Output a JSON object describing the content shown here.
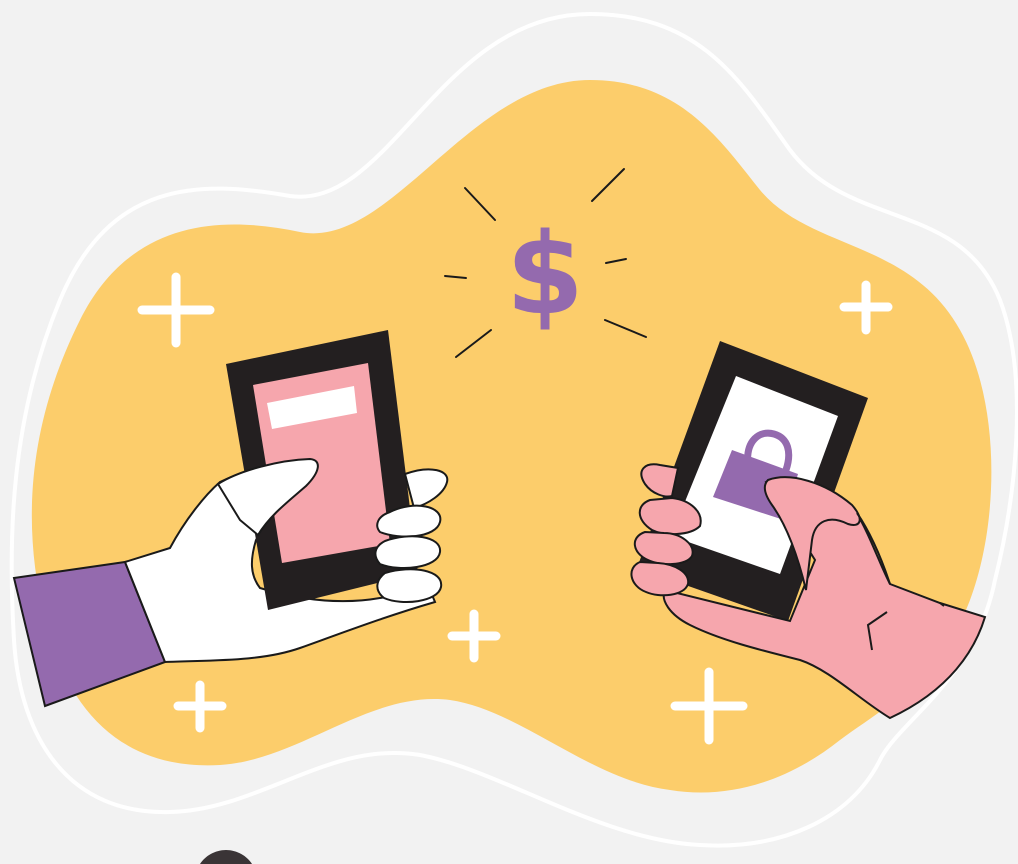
{
  "illustration": {
    "dollar_symbol": "$",
    "colors": {
      "background": "#f2f2f2",
      "blob": "#fccd6b",
      "outline": "#ffffff",
      "purple": "#946aae",
      "pink": "#f6a6ad",
      "phone_frame": "#231f20",
      "ink": "#1a1a1a"
    },
    "icons": [
      "dollar-sign",
      "shopping-bag",
      "sparkle-plus"
    ]
  }
}
